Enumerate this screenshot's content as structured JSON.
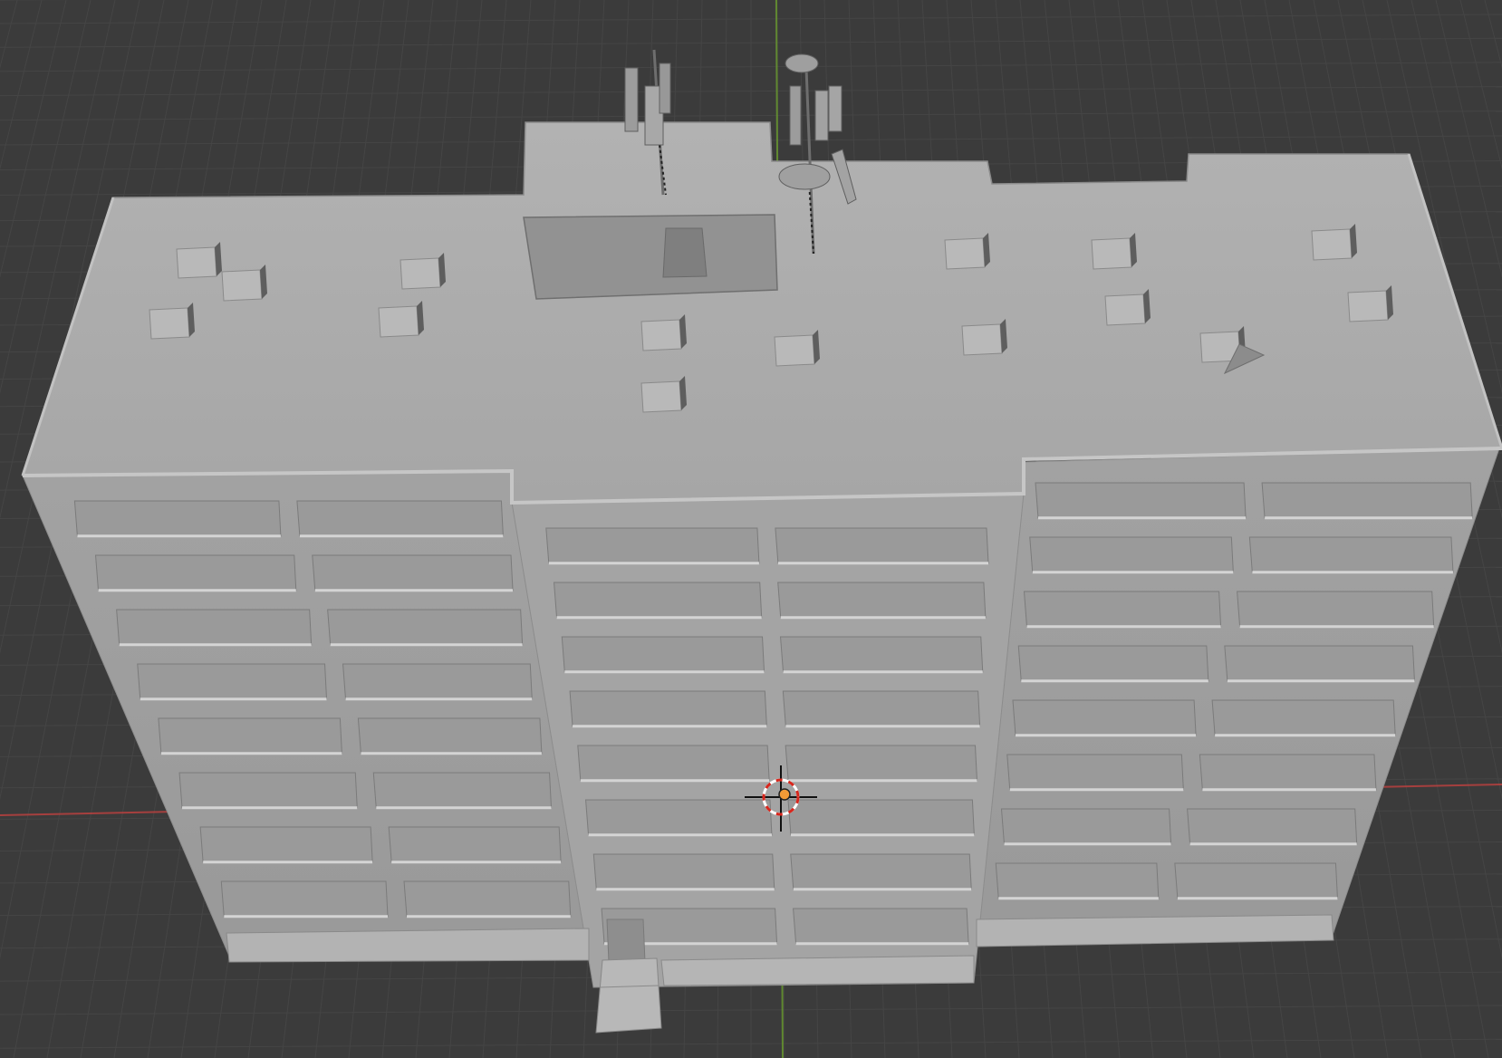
{
  "viewport": {
    "mode": "3d-viewport",
    "background": "#3b3b3b",
    "grid_color": "#454545",
    "x_axis_color": "#c0413f",
    "y_axis_color": "#6a9c2e",
    "cursor_color_primary": "#d8261c",
    "cursor_color_secondary": "#ffffff",
    "origin_color": "#f29a36"
  },
  "model": {
    "name": "",
    "material_color": "#a9a9a9",
    "floors": 8,
    "roof_vents": 15,
    "antennas": 2
  },
  "icons": {
    "cursor": "3d-cursor-icon",
    "origin": "object-origin-icon"
  }
}
